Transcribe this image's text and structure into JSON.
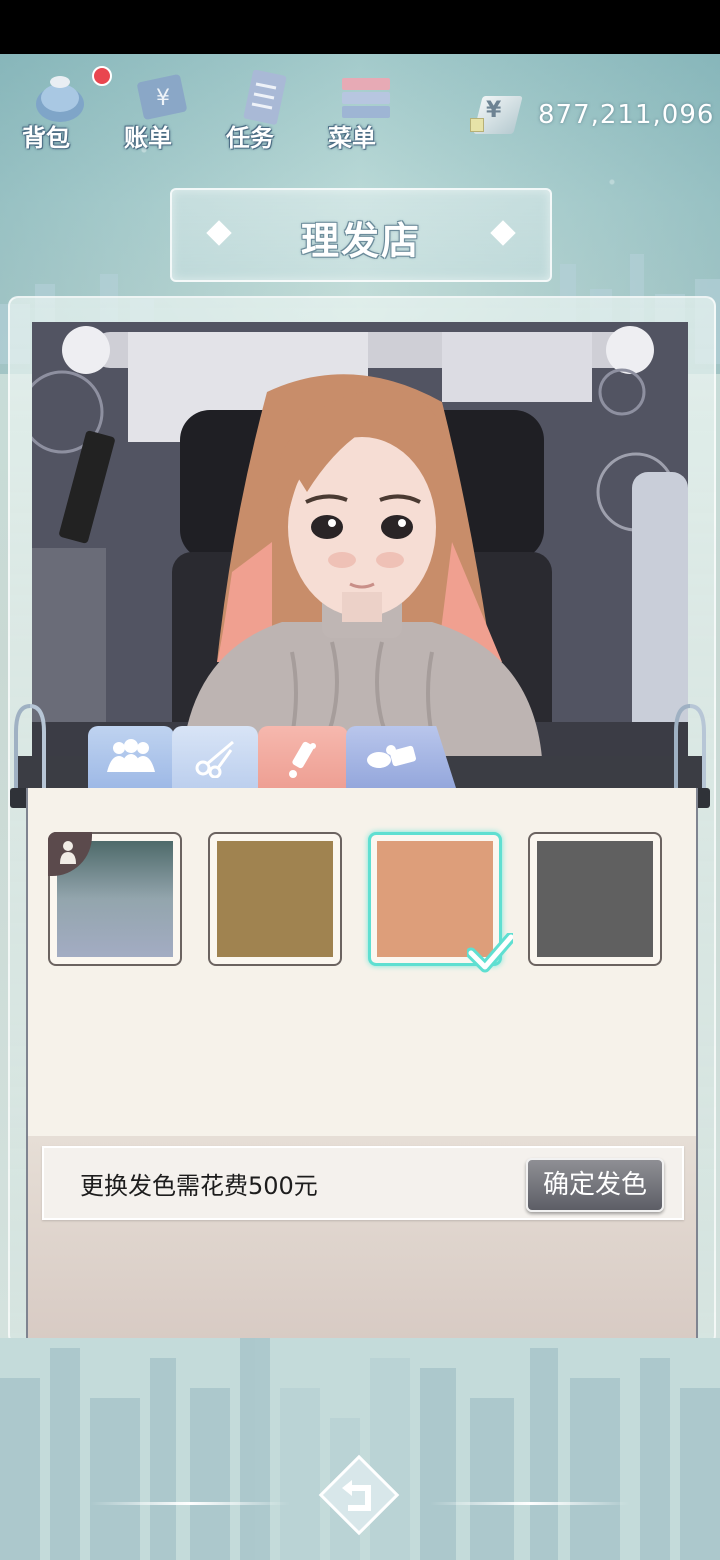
{
  "nav": {
    "items": [
      {
        "label": "背包",
        "icon": "bag-icon",
        "has_notification": true
      },
      {
        "label": "账单",
        "icon": "bill-icon"
      },
      {
        "label": "任务",
        "icon": "task-icon"
      },
      {
        "label": "菜单",
        "icon": "menu-icon"
      }
    ]
  },
  "currency": {
    "symbol": "¥",
    "amount": "877,211,096"
  },
  "page": {
    "title": "理发店"
  },
  "tabs": [
    {
      "name": "people",
      "icon": "people-icon"
    },
    {
      "name": "haircut",
      "icon": "scissors-icon"
    },
    {
      "name": "hair-dye",
      "icon": "dye-icon",
      "active": true
    },
    {
      "name": "accessories",
      "icon": "accessory-icon"
    }
  ],
  "colors": {
    "swatch_1": [
      "#4e6a6a",
      "#9ea9bf"
    ],
    "swatch_2": "#a08350",
    "swatch_3": "#dd9e7a",
    "swatch_4": "#606060",
    "selected_border": "#5fdfd1",
    "confirm_button": "#6e6f77"
  },
  "dye": {
    "cost_text": "更换发色需花费500元",
    "confirm_label": "确定发色",
    "selected_index": 2
  }
}
